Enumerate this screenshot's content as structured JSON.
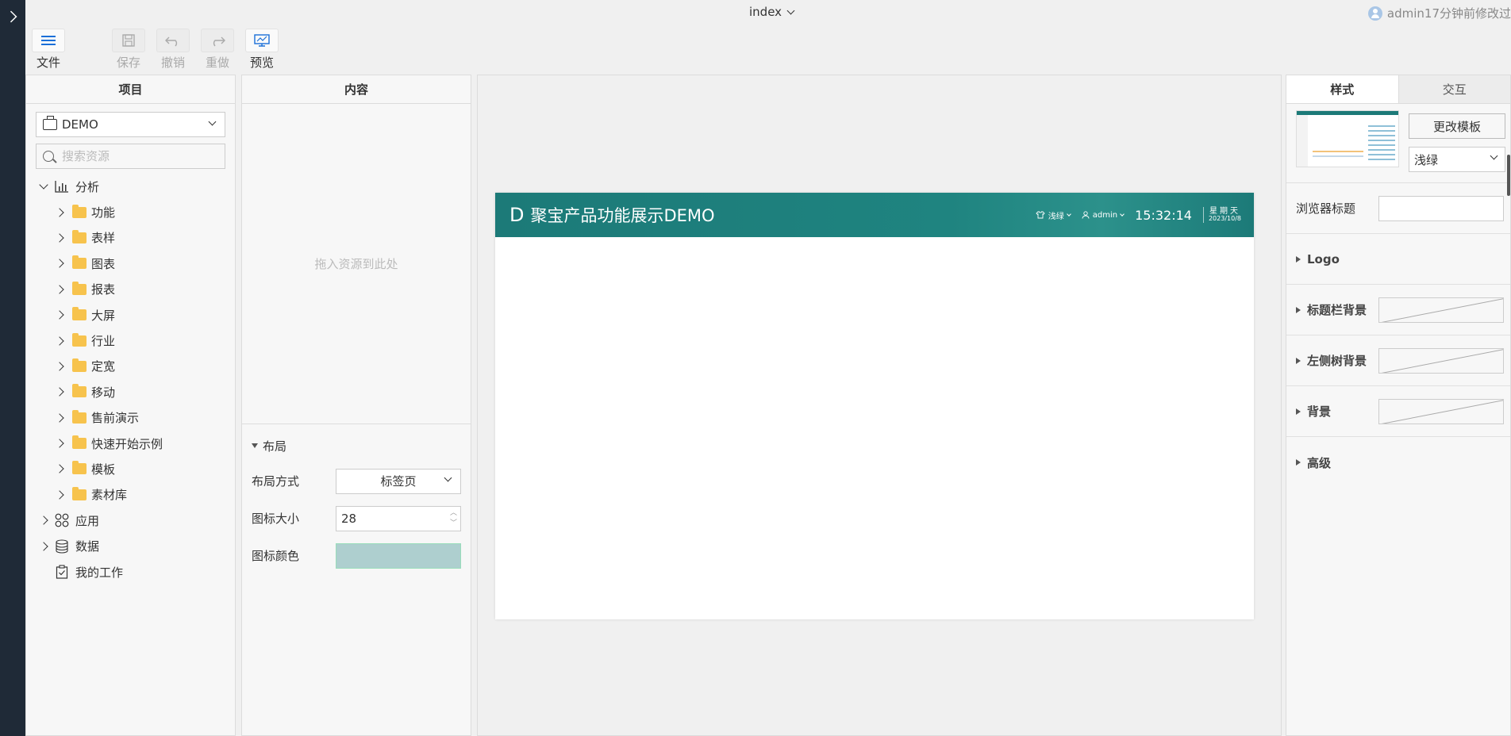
{
  "header": {
    "doc_title": "index",
    "modified_text": "admin17分钟前修改过"
  },
  "toolbar": {
    "file_label": "文件",
    "save_label": "保存",
    "undo_label": "撤销",
    "redo_label": "重做",
    "preview_label": "预览"
  },
  "project_panel": {
    "title": "项目",
    "project_select": "DEMO",
    "search_placeholder": "搜索资源",
    "tree": {
      "analysis": "分析",
      "folders": [
        "功能",
        "表样",
        "图表",
        "报表",
        "大屏",
        "行业",
        "定宽",
        "移动",
        "售前演示",
        "快速开始示例",
        "模板",
        "素材库"
      ],
      "apps": "应用",
      "data": "数据",
      "my_work": "我的工作"
    }
  },
  "content_panel": {
    "title": "内容",
    "drop_hint": "拖入资源到此处",
    "layout_title": "布局",
    "layout_mode_label": "布局方式",
    "layout_mode_value": "标签页",
    "icon_size_label": "图标大小",
    "icon_size_value": "28",
    "icon_color_label": "图标颜色",
    "icon_color": "#aecfcf"
  },
  "preview": {
    "logo": "D",
    "title": "聚宝产品功能展示DEMO",
    "theme": "浅绿",
    "user": "admin",
    "time": "15:32:14",
    "weekday": "星期天",
    "date": "2023/10/8",
    "header_color": "#1c7a78"
  },
  "style_panel": {
    "tab_style": "样式",
    "tab_interaction": "交互",
    "change_template": "更改模板",
    "theme_value": "浅绿",
    "browser_title_label": "浏览器标题",
    "logo_label": "Logo",
    "titlebar_bg_label": "标题栏背景",
    "left_tree_bg_label": "左侧树背景",
    "bg_label": "背景",
    "advanced_label": "高级"
  }
}
